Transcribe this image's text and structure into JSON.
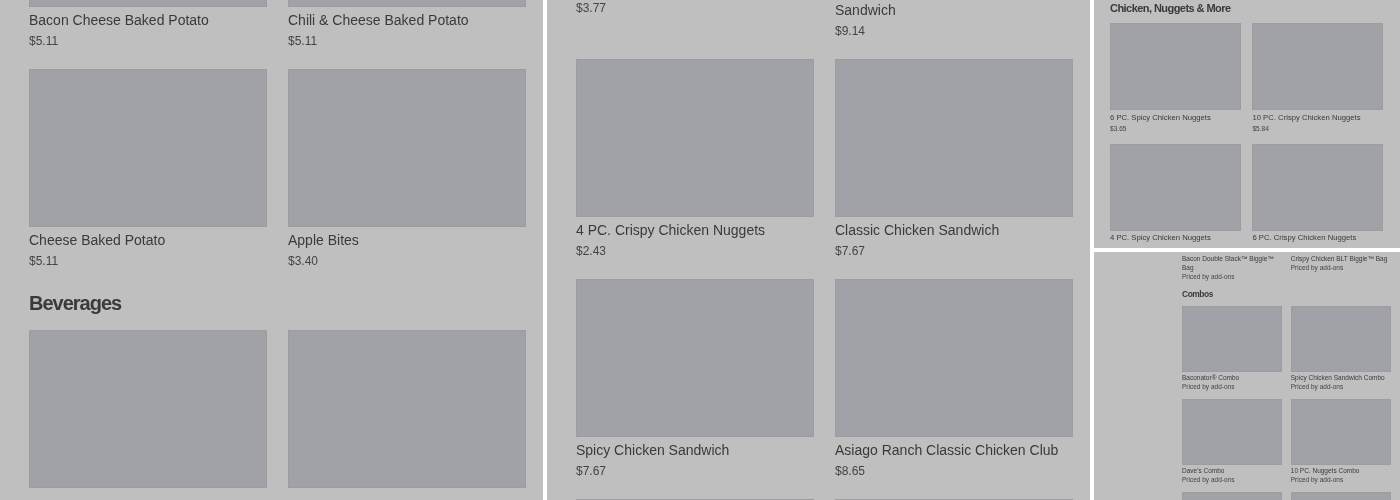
{
  "panels": [
    {
      "sections": [
        {
          "kind": "grid",
          "items": [
            {
              "name": "Bacon Cheese Baked Potato",
              "price": "$5.11"
            },
            {
              "name": "Chili & Cheese Baked Potato",
              "price": "$5.11"
            }
          ]
        },
        {
          "kind": "grid",
          "items": [
            {
              "name": "Cheese Baked Potato",
              "price": "$5.11"
            },
            {
              "name": "Apple Bites",
              "price": "$3.40"
            }
          ]
        },
        {
          "kind": "heading",
          "text": "Beverages"
        },
        {
          "kind": "images"
        }
      ]
    },
    {
      "sections": [
        {
          "kind": "captions",
          "items": [
            {
              "price": "$3.77"
            },
            {
              "name": "Sandwich",
              "price": "$9.14"
            }
          ]
        },
        {
          "kind": "grid",
          "items": [
            {
              "name": "4 PC. Crispy Chicken Nuggets",
              "price": "$2.43"
            },
            {
              "name": "Classic Chicken Sandwich",
              "price": "$7.67"
            }
          ]
        },
        {
          "kind": "grid",
          "items": [
            {
              "name": "Spicy Chicken Sandwich",
              "price": "$7.67"
            },
            {
              "name": "Asiago Ranch Classic Chicken Club",
              "price": "$8.65"
            }
          ]
        },
        {
          "kind": "images"
        }
      ]
    },
    {
      "sections": [
        {
          "kind": "heading",
          "text": "Chicken, Nuggets & More"
        },
        {
          "kind": "grid",
          "items": [
            {
              "name": "6 PC. Spicy Chicken Nuggets",
              "price": "$3.65"
            },
            {
              "name": "10 PC. Crispy Chicken Nuggets",
              "price": "$5.84"
            }
          ]
        },
        {
          "kind": "grid",
          "items": [
            {
              "name": "4 PC. Spicy Chicken Nuggets"
            },
            {
              "name": "6 PC. Crispy Chicken Nuggets"
            }
          ]
        }
      ]
    },
    {
      "sections": [
        {
          "kind": "captions",
          "items": [
            {
              "name": "Bacon Double Stack™ Biggie™ Bag",
              "price": "Priced by add-ons"
            },
            {
              "name": "Crispy Chicken BLT Biggie™ Bag",
              "price": "Priced by add-ons"
            }
          ]
        },
        {
          "kind": "heading",
          "text": "Combos"
        },
        {
          "kind": "grid",
          "items": [
            {
              "name": "Baconator® Combo",
              "price": "Priced by add-ons"
            },
            {
              "name": "Spicy Chicken Sandwich Combo",
              "price": "Priced by add-ons"
            }
          ]
        },
        {
          "kind": "grid",
          "items": [
            {
              "name": "Dave's Combo",
              "price": "Priced by add-ons"
            },
            {
              "name": "10 PC. Nuggets Combo",
              "price": "Priced by add-ons"
            }
          ]
        },
        {
          "kind": "images"
        }
      ]
    }
  ]
}
